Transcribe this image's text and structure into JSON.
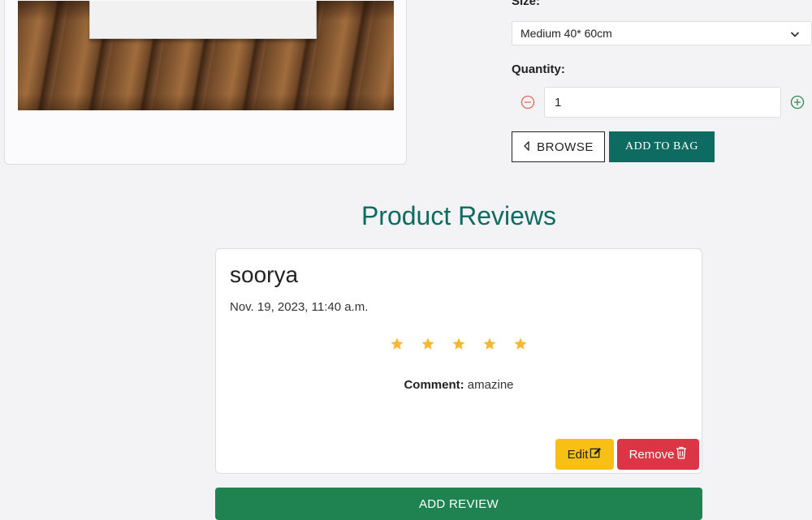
{
  "product": {
    "image_alt": "canvas print on wooden floor",
    "size_label": "Size:",
    "size_selected": "Medium 40* 60cm",
    "quantity_label": "Quantity:",
    "quantity_value": "1",
    "browse_label": "BROWSE",
    "add_to_bag_label": "ADD TO BAG"
  },
  "reviews": {
    "heading": "Product Reviews",
    "items": [
      {
        "reviewer": "soorya",
        "date": "Nov. 19, 2023, 11:40 a.m.",
        "rating": 5,
        "comment_label": "Comment:",
        "comment": " amazine",
        "edit_label": "Edit",
        "remove_label": "Remove"
      }
    ],
    "add_review_label": "ADD REVIEW"
  },
  "colors": {
    "brand": "#0e6b61",
    "star": "#f5b82e",
    "edit": "#f8bf14",
    "remove": "#dc3545",
    "add_review": "#1f8251",
    "qty_minus": "#e06a5a",
    "qty_plus": "#2e8b57"
  },
  "icons": {
    "select": "chevron-down-icon",
    "minus": "minus-circle-icon",
    "plus": "plus-circle-icon",
    "browse": "caret-left-icon",
    "edit": "edit-icon",
    "remove": "trash-icon",
    "rating": "star-icon"
  }
}
